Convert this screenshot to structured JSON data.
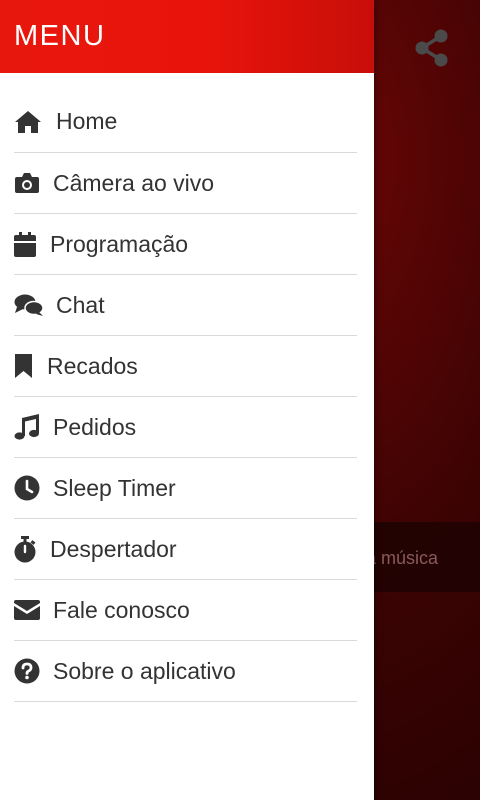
{
  "drawer": {
    "title": "MENU",
    "items": [
      {
        "label": "Home",
        "icon": "home-icon"
      },
      {
        "label": "Câmera ao vivo",
        "icon": "camera-icon"
      },
      {
        "label": "Programação",
        "icon": "calendar-icon"
      },
      {
        "label": "Chat",
        "icon": "chat-icon"
      },
      {
        "label": "Recados",
        "icon": "bookmark-icon"
      },
      {
        "label": "Pedidos",
        "icon": "music-icon"
      },
      {
        "label": "Sleep Timer",
        "icon": "clock-icon"
      },
      {
        "label": "Despertador",
        "icon": "stopwatch-icon"
      },
      {
        "label": "Fale conosco",
        "icon": "envelope-icon"
      },
      {
        "label": "Sobre o aplicativo",
        "icon": "question-icon"
      }
    ]
  },
  "background": {
    "band_text": "a música",
    "share_icon": "share-icon"
  },
  "colors": {
    "header_red": "#e8170d",
    "text_dark": "#333333",
    "background_dark_red": "#3d0303"
  }
}
